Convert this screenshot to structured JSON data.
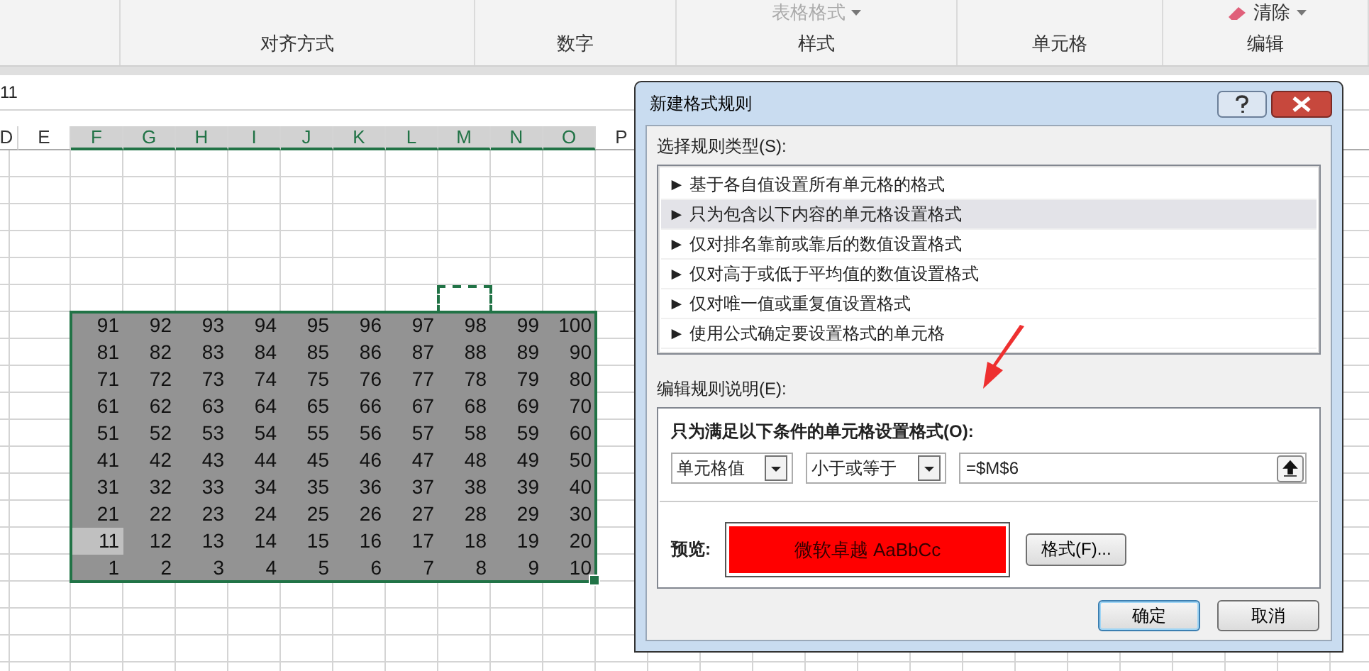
{
  "ribbon": {
    "groups": [
      {
        "label": "对齐方式"
      },
      {
        "label": "数字"
      },
      {
        "label": "样式",
        "items": [
          {
            "kind": "dropdown",
            "label": "表格格式"
          }
        ]
      },
      {
        "label": "单元格"
      },
      {
        "label": "编辑",
        "items": [
          {
            "kind": "eraser",
            "label": "清除"
          }
        ]
      }
    ]
  },
  "formula_bar": {
    "value": "11"
  },
  "sheet": {
    "columns": [
      {
        "label": "D",
        "selected": false,
        "marquee": false
      },
      {
        "label": "E",
        "selected": false,
        "marquee": false
      },
      {
        "label": "F",
        "selected": true,
        "marquee": false
      },
      {
        "label": "G",
        "selected": true,
        "marquee": false
      },
      {
        "label": "H",
        "selected": true,
        "marquee": false
      },
      {
        "label": "I",
        "selected": true,
        "marquee": false
      },
      {
        "label": "J",
        "selected": true,
        "marquee": false
      },
      {
        "label": "K",
        "selected": true,
        "marquee": false
      },
      {
        "label": "L",
        "selected": true,
        "marquee": false
      },
      {
        "label": "M",
        "selected": true,
        "marquee": true
      },
      {
        "label": "N",
        "selected": true,
        "marquee": false
      },
      {
        "label": "O",
        "selected": true,
        "marquee": false
      },
      {
        "label": "P",
        "selected": false,
        "marquee": false
      }
    ],
    "rows": [
      [
        {
          "v": "91",
          "active": false
        },
        {
          "v": "92",
          "active": false
        },
        {
          "v": "93",
          "active": false
        },
        {
          "v": "94",
          "active": false
        },
        {
          "v": "95",
          "active": false
        },
        {
          "v": "96",
          "active": false
        },
        {
          "v": "97",
          "active": false
        },
        {
          "v": "98",
          "active": false
        },
        {
          "v": "99",
          "active": false
        },
        {
          "v": "100",
          "active": false
        }
      ],
      [
        {
          "v": "81",
          "active": false
        },
        {
          "v": "82",
          "active": false
        },
        {
          "v": "83",
          "active": false
        },
        {
          "v": "84",
          "active": false
        },
        {
          "v": "85",
          "active": false
        },
        {
          "v": "86",
          "active": false
        },
        {
          "v": "87",
          "active": false
        },
        {
          "v": "88",
          "active": false
        },
        {
          "v": "89",
          "active": false
        },
        {
          "v": "90",
          "active": false
        }
      ],
      [
        {
          "v": "71",
          "active": false
        },
        {
          "v": "72",
          "active": false
        },
        {
          "v": "73",
          "active": false
        },
        {
          "v": "74",
          "active": false
        },
        {
          "v": "75",
          "active": false
        },
        {
          "v": "76",
          "active": false
        },
        {
          "v": "77",
          "active": false
        },
        {
          "v": "78",
          "active": false
        },
        {
          "v": "79",
          "active": false
        },
        {
          "v": "80",
          "active": false
        }
      ],
      [
        {
          "v": "61",
          "active": false
        },
        {
          "v": "62",
          "active": false
        },
        {
          "v": "63",
          "active": false
        },
        {
          "v": "64",
          "active": false
        },
        {
          "v": "65",
          "active": false
        },
        {
          "v": "66",
          "active": false
        },
        {
          "v": "67",
          "active": false
        },
        {
          "v": "68",
          "active": false
        },
        {
          "v": "69",
          "active": false
        },
        {
          "v": "70",
          "active": false
        }
      ],
      [
        {
          "v": "51",
          "active": false
        },
        {
          "v": "52",
          "active": false
        },
        {
          "v": "53",
          "active": false
        },
        {
          "v": "54",
          "active": false
        },
        {
          "v": "55",
          "active": false
        },
        {
          "v": "56",
          "active": false
        },
        {
          "v": "57",
          "active": false
        },
        {
          "v": "58",
          "active": false
        },
        {
          "v": "59",
          "active": false
        },
        {
          "v": "60",
          "active": false
        }
      ],
      [
        {
          "v": "41",
          "active": false
        },
        {
          "v": "42",
          "active": false
        },
        {
          "v": "43",
          "active": false
        },
        {
          "v": "44",
          "active": false
        },
        {
          "v": "45",
          "active": false
        },
        {
          "v": "46",
          "active": false
        },
        {
          "v": "47",
          "active": false
        },
        {
          "v": "48",
          "active": false
        },
        {
          "v": "49",
          "active": false
        },
        {
          "v": "50",
          "active": false
        }
      ],
      [
        {
          "v": "31",
          "active": false
        },
        {
          "v": "32",
          "active": false
        },
        {
          "v": "33",
          "active": false
        },
        {
          "v": "34",
          "active": false
        },
        {
          "v": "35",
          "active": false
        },
        {
          "v": "36",
          "active": false
        },
        {
          "v": "37",
          "active": false
        },
        {
          "v": "38",
          "active": false
        },
        {
          "v": "39",
          "active": false
        },
        {
          "v": "40",
          "active": false
        }
      ],
      [
        {
          "v": "21",
          "active": false
        },
        {
          "v": "22",
          "active": false
        },
        {
          "v": "23",
          "active": false
        },
        {
          "v": "24",
          "active": false
        },
        {
          "v": "25",
          "active": false
        },
        {
          "v": "26",
          "active": false
        },
        {
          "v": "27",
          "active": false
        },
        {
          "v": "28",
          "active": false
        },
        {
          "v": "29",
          "active": false
        },
        {
          "v": "30",
          "active": false
        }
      ],
      [
        {
          "v": "11",
          "active": true
        },
        {
          "v": "12",
          "active": false
        },
        {
          "v": "13",
          "active": false
        },
        {
          "v": "14",
          "active": false
        },
        {
          "v": "15",
          "active": false
        },
        {
          "v": "16",
          "active": false
        },
        {
          "v": "17",
          "active": false
        },
        {
          "v": "18",
          "active": false
        },
        {
          "v": "19",
          "active": false
        },
        {
          "v": "20",
          "active": false
        }
      ],
      [
        {
          "v": "1",
          "active": false
        },
        {
          "v": "2",
          "active": false
        },
        {
          "v": "3",
          "active": false
        },
        {
          "v": "4",
          "active": false
        },
        {
          "v": "5",
          "active": false
        },
        {
          "v": "6",
          "active": false
        },
        {
          "v": "7",
          "active": false
        },
        {
          "v": "8",
          "active": false
        },
        {
          "v": "9",
          "active": false
        },
        {
          "v": "10",
          "active": false
        }
      ]
    ]
  },
  "dialog": {
    "title": "新建格式规则",
    "rule_types_label": "选择规则类型(S):",
    "rule_types": [
      {
        "label": "► 基于各自值设置所有单元格的格式",
        "selected": false
      },
      {
        "label": "► 只为包含以下内容的单元格设置格式",
        "selected": true
      },
      {
        "label": "► 仅对排名靠前或靠后的数值设置格式",
        "selected": false
      },
      {
        "label": "► 仅对高于或低于平均值的数值设置格式",
        "selected": false
      },
      {
        "label": "► 仅对唯一值或重复值设置格式",
        "selected": false
      },
      {
        "label": "► 使用公式确定要设置格式的单元格",
        "selected": false
      }
    ],
    "edit_label": "编辑规则说明(E):",
    "condition_title": "只为满足以下条件的单元格设置格式(O):",
    "dropdowns": [
      "单元格值",
      "小于或等于"
    ],
    "formula": "=$M$6",
    "preview_label": "预览:",
    "preview": {
      "text": "微软卓越  AaBbCc",
      "color": "#ff0000"
    },
    "format_button": "格式(F)...",
    "buttons": [
      {
        "label": "确定",
        "default": true
      },
      {
        "label": "取消",
        "default": false
      }
    ]
  }
}
